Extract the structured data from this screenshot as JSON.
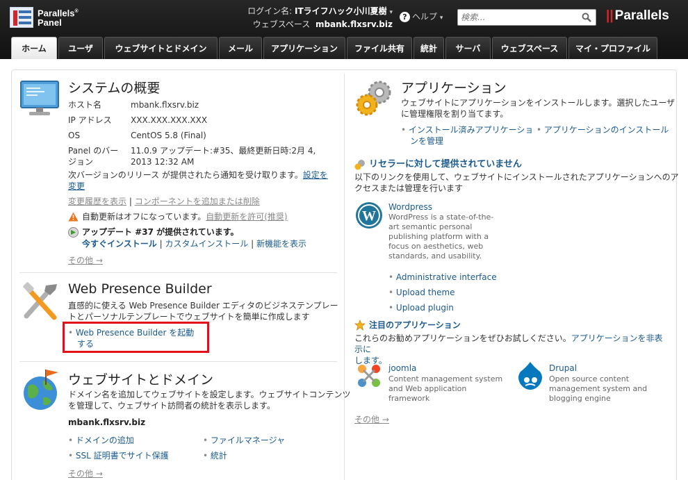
{
  "header": {
    "logo_line1": "Parallels",
    "logo_reg": "®",
    "logo_line2": "Panel",
    "login_label": "ログイン名:",
    "login_user": "ITライフハック小川夏樹",
    "webspace_label": "ウェブスペース",
    "webspace_value": "mbank.flxsrv.biz",
    "help_label": "ヘルプ",
    "search_placeholder": "検索...",
    "brand": "Parallels"
  },
  "tabs": [
    {
      "label": "ホーム",
      "active": true
    },
    {
      "label": "ユーザ"
    },
    {
      "label": "ウェブサイトとドメイン"
    },
    {
      "label": "メール"
    },
    {
      "label": "アプリケーション"
    },
    {
      "label": "ファイル共有"
    },
    {
      "label": "統計"
    },
    {
      "label": "サーバ"
    },
    {
      "label": "ウェブスペース"
    },
    {
      "label": "マイ・プロファイル"
    }
  ],
  "system": {
    "title": "システムの概要",
    "rows": [
      {
        "label": "ホスト名",
        "value": "mbank.flxsrv.biz"
      },
      {
        "label": "IP アドレス",
        "value": "XXX.XXX.XXX.XXX"
      },
      {
        "label": "OS",
        "value": "CentOS 5.8 (Final)"
      },
      {
        "label_line1": "Panel のバー",
        "label_line2": "ジョン",
        "value_line1": "11.0.9 アップデート:#35、最終更新日時:2月 4,",
        "value_line2": "2013 12:32 AM"
      }
    ],
    "notify_text": "次バージョンのリリース が提供されたら通知を受け取ります。",
    "notify_link1": "設定を",
    "notify_link2": "変更",
    "history_link": "変更履歴を表示",
    "sep": "|",
    "component_link": "コンポーネントを追加または削除",
    "autoupdate_text": "自動更新はオフになっています。",
    "autoupdate_link": "自動更新を許可(推奨)",
    "update_text": "アップデート #37 が提供されています。",
    "install_now": "今すぐインストール",
    "custom_install": "カスタムインストール",
    "new_features": "新機能を表示",
    "more": "その他 →"
  },
  "wpb": {
    "title": "Web Presence Builder",
    "desc_line1": "直感的に使える Web Presence Builder エディタのビジネステンプレー",
    "desc_line2": "トとパーソナルテンプレートでウェブサイトを簡単に作成します",
    "launch_line1": "Web Presence Builder を起動",
    "launch_line2": "する"
  },
  "websites": {
    "title": "ウェブサイトとドメイン",
    "desc_line1": "ドメイン名を追加してウェブサイトを設定します。ウェブサイトコンテンツ",
    "desc_line2": "を管理して、ウェブサイト訪問者の統計を表示します。",
    "domain": "mbank.flxsrv.biz",
    "links": [
      "ドメインの追加",
      "ファイルマネージャ",
      "SSL 証明書でサイト保護",
      "統計"
    ],
    "more": "その他 →"
  },
  "apps": {
    "title": "アプリケーション",
    "desc_line1": "ウェブサイトにアプリケーションをインストールします。選択したユーザ",
    "desc_line2": "に管理権限を割り当てます。",
    "link_installed_1": "インストール済みアプリケーショ",
    "link_installed_2": "ンを管理",
    "link_install": "アプリケーションのインストール",
    "reseller_title": "リセラーに対して提供されていません",
    "reseller_desc_line1": "以下のリンクを使用して、ウェブサイトにインストールされたアプリケーションへのア",
    "reseller_desc_line2": "クセスまたは管理を行います",
    "wordpress_name": "Wordpress",
    "wordpress_desc": [
      "WordPress is a state-of-the-",
      "art semantic personal",
      "publishing platform with a",
      "focus on aesthetics, web",
      "standards, and usability."
    ],
    "wp_links": [
      "Administrative interface",
      "Upload theme",
      "Upload plugin"
    ],
    "featured_title": "注目のアプリケーション",
    "featured_desc": "これらのお勧めアプリケーションをぜひお試しください。",
    "hide_link_1": "アプリケーションを非表示に",
    "hide_link_2": "します。",
    "joomla_name": "joomla",
    "joomla_desc": [
      "Content management system",
      "and Web application",
      "framework"
    ],
    "drupal_name": "Drupal",
    "drupal_desc": [
      "Open source content",
      "management system and",
      "blogging engine"
    ],
    "more": "その他 →"
  }
}
